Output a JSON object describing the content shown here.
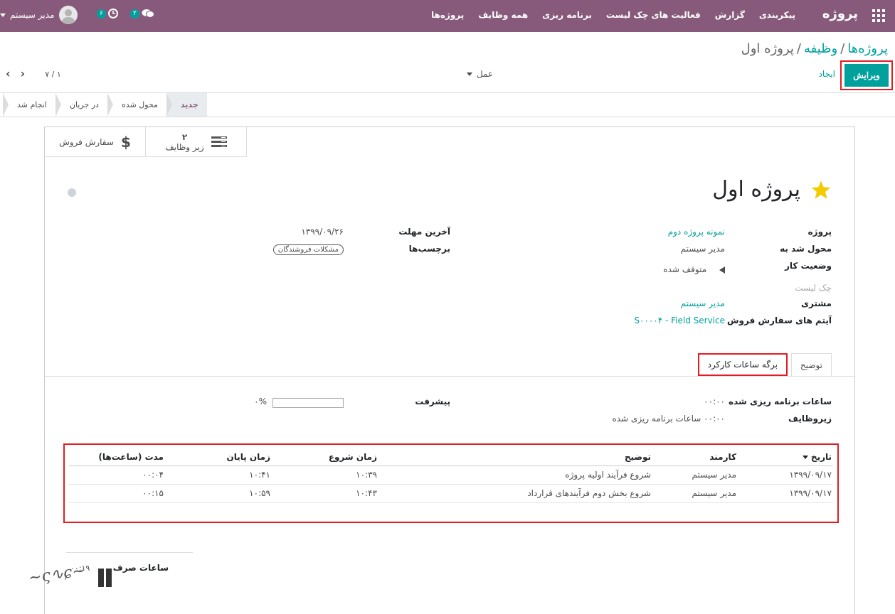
{
  "navbar": {
    "brand": "پروژه",
    "menu": [
      "پروژه‌ها",
      "همه وظایف",
      "برنامه ریزی",
      "فعالیت های چک لیست",
      "گزارش",
      "پیکربندی"
    ],
    "messages_count": "۲",
    "activities_count": "۶",
    "user_name": "مدیر سیستم",
    "accent": "#875a7b"
  },
  "breadcrumb": {
    "root": "پروژه‌ها",
    "parent": "وظیفه",
    "current": "پروژه اول"
  },
  "controls": {
    "edit_label": "ویرایش",
    "create_label": "ایجاد",
    "action_label": "عمل",
    "pager": "۱ / ۷"
  },
  "stages": [
    "جدید",
    "محول شده",
    "در جریان",
    "انجام شد"
  ],
  "active_stage": "جدید",
  "smart_buttons": {
    "subtasks_count": "۲",
    "subtasks_label": "زیر وظایف",
    "sales_order_label": "سفارش فروش"
  },
  "task": {
    "title": "پروژه اول",
    "fields_right": {
      "project_label": "پروژه",
      "project_value": "نمونه پروژه دوم",
      "assigned_label": "محول شد به",
      "assigned_value": "مدیر سیستم",
      "status_label": "وضعیت کار",
      "status_value": "متوقف شده",
      "checklist_label": "چک لیست",
      "customer_label": "مشتری",
      "customer_value": "مدیر سیستم",
      "sale_item_label": "آیتم های سفارش فروش",
      "sale_item_value": "S۰۰۰۰۴ - Field Service"
    },
    "fields_left": {
      "deadline_label": "آخرین مهلت",
      "deadline_value": "۱۳۹۹/۰۹/۲۶",
      "tags_label": "برچسب‌ها",
      "tags_value": "مشکلات فروشندگان"
    }
  },
  "tabs": {
    "description": "توضیح",
    "timesheet": "برگه ساعات کارکرد"
  },
  "timesheet_summary": {
    "planned_label": "ساعات برنامه ریزی شده",
    "planned_value": "۰۰:۰۰",
    "subtasks_label": "زیروظایف",
    "subtasks_value": "۰۰:۰۰ ساعات برنامه ریزی شده",
    "progress_label": "پیشرفت",
    "progress_value": "۰%",
    "progress_fraction": 0
  },
  "timesheet_table": {
    "headers": {
      "date": "تاریخ",
      "employee": "کارمند",
      "description": "توضیح",
      "start": "زمان شروع",
      "end": "زمان پایان",
      "duration": "مدت (ساعت‌ها)"
    },
    "rows": [
      {
        "date": "۱۳۹۹/۰۹/۱۷",
        "employee": "مدیر سیستم",
        "description": "شروع فرآیند اولیه پروژه",
        "start": "۱۰:۳۹",
        "end": "۱۰:۴۱",
        "duration": "۰۰:۰۴"
      },
      {
        "date": "۱۳۹۹/۰۹/۱۷",
        "employee": "مدیر سیستم",
        "description": "شروع بخش دوم فرآیندهای قرارداد",
        "start": "۱۰:۴۳",
        "end": "۱۰:۵۹",
        "duration": "۰۰:۱۵"
      }
    ]
  },
  "total": {
    "label": "ساعات صرف",
    "value": "۰۰:۱۹"
  },
  "colors": {
    "primary": "#00a09d",
    "highlight_border": "#e31b23",
    "star": "#f3cc00"
  }
}
